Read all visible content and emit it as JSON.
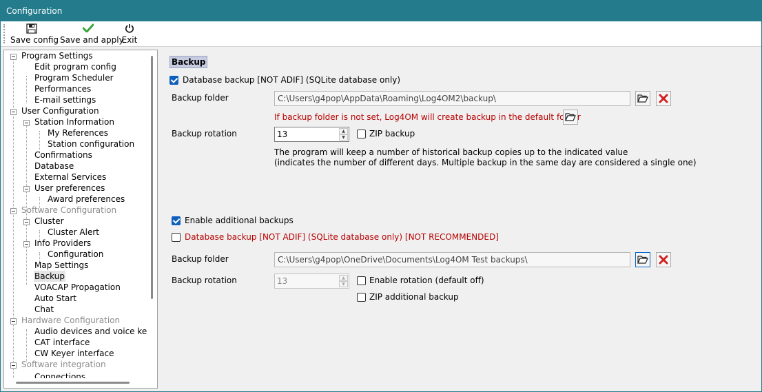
{
  "window": {
    "title": "Configuration"
  },
  "toolbar": {
    "save_config": "Save config",
    "save_and_apply": "Save and apply",
    "exit": "Exit"
  },
  "tree": [
    {
      "label": "Program Settings",
      "grey": false
    },
    {
      "label": "Edit program config"
    },
    {
      "label": "Program Scheduler"
    },
    {
      "label": "Performances"
    },
    {
      "label": "E-mail settings"
    },
    {
      "label": "User Configuration",
      "grey": false
    },
    {
      "label": "Station Information"
    },
    {
      "label": "My References"
    },
    {
      "label": "Station configuration"
    },
    {
      "label": "Confirmations"
    },
    {
      "label": "Database"
    },
    {
      "label": "External Services"
    },
    {
      "label": "User preferences"
    },
    {
      "label": "Award preferences"
    },
    {
      "label": "Software Configuration",
      "grey": true
    },
    {
      "label": "Cluster"
    },
    {
      "label": "Cluster Alert"
    },
    {
      "label": "Info Providers"
    },
    {
      "label": "Configuration"
    },
    {
      "label": "Map Settings"
    },
    {
      "label": "Backup",
      "selected": true
    },
    {
      "label": "VOACAP Propagation"
    },
    {
      "label": "Auto Start"
    },
    {
      "label": "Chat"
    },
    {
      "label": "Hardware Configuration",
      "grey": true
    },
    {
      "label": "Audio devices and voice keyer"
    },
    {
      "label": "CAT interface"
    },
    {
      "label": "CW Keyer interface"
    },
    {
      "label": "Software integration",
      "grey": true
    },
    {
      "label": "Connections"
    }
  ],
  "backup": {
    "title": "Backup",
    "db_backup_label": "Database backup [NOT ADIF] (SQLite database only)",
    "db_backup_checked": true,
    "folder_label": "Backup folder",
    "folder_value": "C:\\Users\\g4pop\\AppData\\Roaming\\Log4OM2\\backup\\",
    "folder_warning": "If backup folder is not set, Log4OM will create backup in the default folder",
    "rotation_label": "Backup rotation",
    "rotation_value": "13",
    "zip_label": "ZIP backup",
    "zip_checked": false,
    "info_line1": "The program will keep a number of historical backup copies up to the indicated value",
    "info_line2": "(indicates the number of different days. Multiple backup in the same day are considered a single one)"
  },
  "additional": {
    "enable_label": "Enable additional backups",
    "enable_checked": true,
    "db_backup_label": "Database backup [NOT ADIF] (SQLite database only) [NOT RECOMMENDED]",
    "db_backup_checked": false,
    "folder_label": "Backup folder",
    "folder_value": "C:\\Users\\g4pop\\OneDrive\\Documents\\Log4OM Test backups\\",
    "rotation_label": "Backup rotation",
    "rotation_value": "13",
    "enable_rotation_label": "Enable rotation (default off)",
    "enable_rotation_checked": false,
    "zip_label": "ZIP additional backup",
    "zip_checked": false
  },
  "icons": {
    "save": "floppy-disk-icon",
    "apply": "green-checkmark-icon",
    "exit": "power-icon",
    "folder": "open-folder-icon",
    "clear": "red-x-icon"
  },
  "colors": {
    "titlebar": "#237b8c",
    "warning_text": "#b80000",
    "checkbox_checked": "#0f5fbd"
  }
}
